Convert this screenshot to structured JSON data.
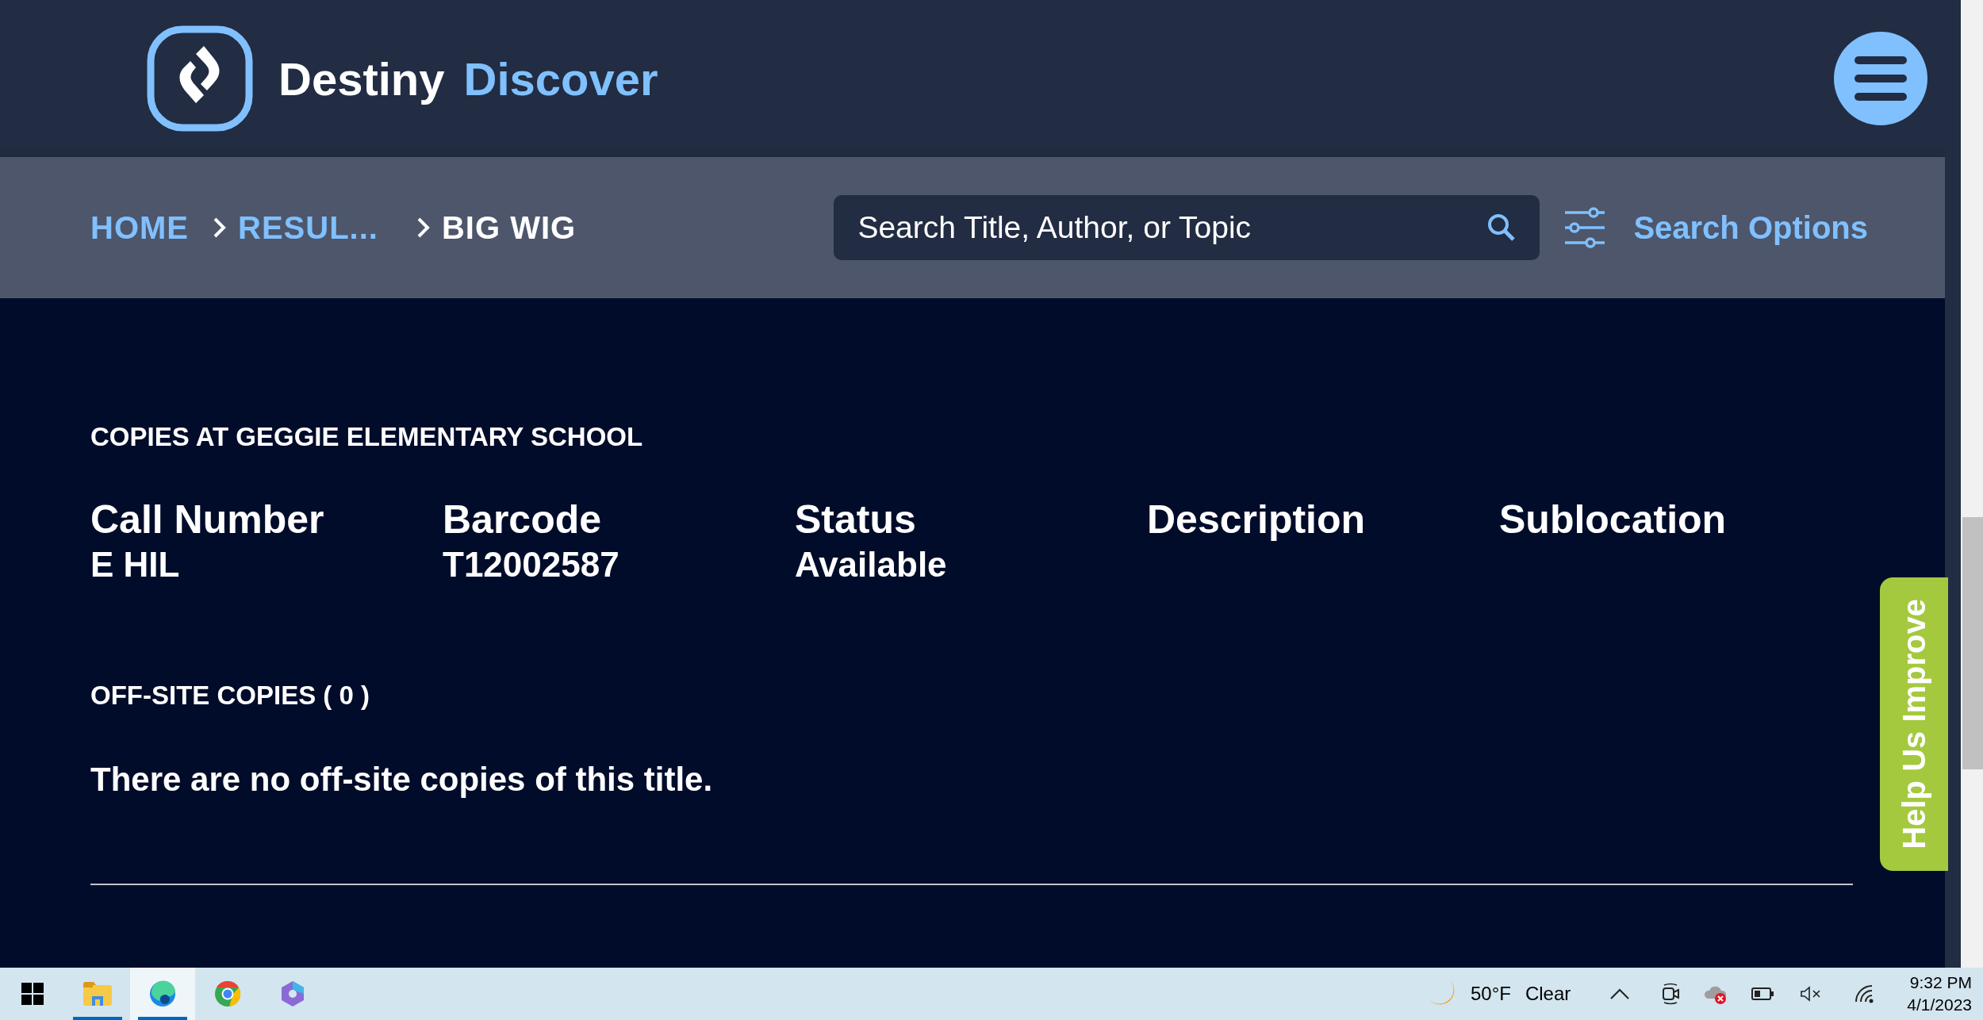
{
  "header": {
    "brand_primary": "Destiny",
    "brand_secondary": "Discover"
  },
  "breadcrumb": [
    {
      "label": "HOME",
      "selected": false
    },
    {
      "label": "RESUL...",
      "selected": false
    },
    {
      "label": "BIG WIG",
      "selected": true
    }
  ],
  "search": {
    "placeholder": "Search Title, Author, or Topic",
    "options_label": "Search Options"
  },
  "copies": {
    "heading": "COPIES AT GEGGIE ELEMENTARY SCHOOL",
    "columns": [
      {
        "header": "Call Number",
        "value": "E HIL"
      },
      {
        "header": "Barcode",
        "value": "T12002587"
      },
      {
        "header": "Status",
        "value": "Available"
      },
      {
        "header": "Description"
      },
      {
        "header": "Sublocation"
      }
    ]
  },
  "offsite": {
    "heading": "OFF-SITE COPIES ( 0 )",
    "message": "There are no off-site copies of this title."
  },
  "feedback_tab": {
    "label": "Help Us Improve"
  },
  "taskbar": {
    "apps": [
      {
        "kind": "start",
        "running": false,
        "selected": false
      },
      {
        "kind": "files",
        "running": true,
        "selected": false
      },
      {
        "kind": "edge",
        "running": true,
        "selected": true
      },
      {
        "kind": "chrome",
        "running": false,
        "selected": false
      },
      {
        "kind": "copilot",
        "running": false,
        "selected": false
      }
    ],
    "weather": {
      "temperature": "50°F",
      "condition": "Clear"
    },
    "time": "9:32 PM",
    "date": "4/1/2023"
  }
}
